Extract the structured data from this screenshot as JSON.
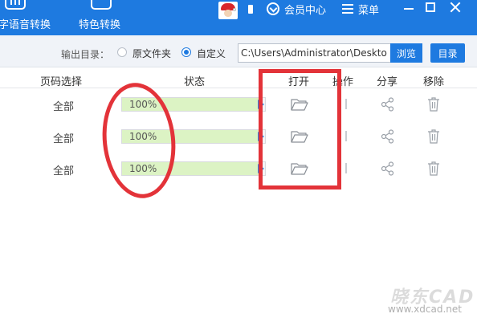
{
  "topbar": {
    "tools": [
      {
        "label": "字语音转换"
      },
      {
        "label": "特色转换"
      }
    ],
    "vip_label": "会员中心",
    "menu_label": "菜单"
  },
  "output": {
    "label": "输出目录：",
    "option_original": "原文件夹",
    "option_custom": "自定义",
    "selected": "自定义",
    "path_value": "C:\\Users\\Administrator\\Deskto",
    "browse_label": "浏览",
    "directory_label": "目录"
  },
  "table": {
    "headers": {
      "pages": "页码选择",
      "status": "状态",
      "open": "打开",
      "operate": "操作",
      "share": "分享",
      "remove": "移除"
    },
    "rows": [
      {
        "pages": "全部",
        "progress": 100,
        "progress_label": "100%"
      },
      {
        "pages": "全部",
        "progress": 100,
        "progress_label": "100%"
      },
      {
        "pages": "全部",
        "progress": 100,
        "progress_label": "100%"
      }
    ]
  },
  "watermark": {
    "brand": "晓东CAD",
    "url": "www.xdcad.net"
  },
  "colors": {
    "accent": "#1e7ae0",
    "progress_fill": "#dcf3c4",
    "annotation": "#e33339"
  },
  "icons": {
    "open": "folder-icon",
    "share": "share-icon",
    "remove": "trash-icon"
  }
}
